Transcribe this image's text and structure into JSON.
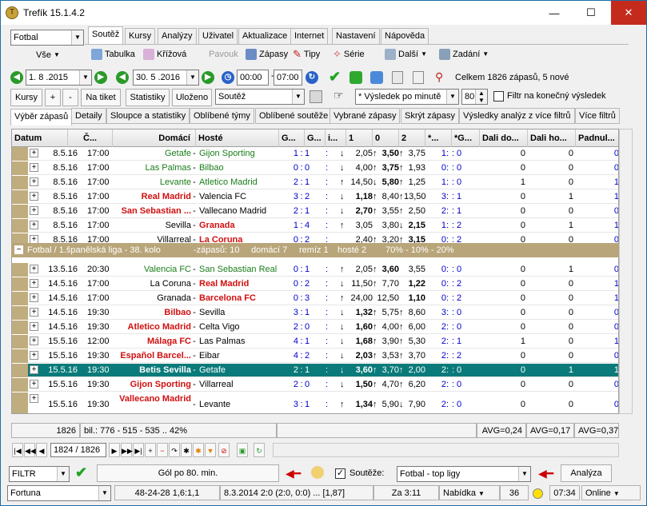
{
  "window": {
    "title": "Trefík 15.1.4.2",
    "minimize": "—",
    "maximize": "☐",
    "close": "✕"
  },
  "sport_select": "Fotbal",
  "all_select": "Vše",
  "menu_tabs": [
    "Soutěž",
    "Kursy",
    "Analýzy",
    "Uživatel",
    "Aktualizace",
    "Internet",
    "Nastavení",
    "Nápověda"
  ],
  "toolbar": {
    "tabulka": "Tabulka",
    "krizova": "Křížová",
    "pavouk": "Pavouk",
    "zapasy": "Zápasy",
    "tipy": "Tipy",
    "serie": "Série",
    "dalsi": "Další",
    "zadani": "Zadání"
  },
  "date_from": "1. 8 .2015",
  "date_to": "30. 5 .2016",
  "time_from": "00:00",
  "time_to": "07:00",
  "summary": "Celkem 1826 zápasů, 5 nové",
  "filter_row": {
    "kursy": "Kursy",
    "plus": "+",
    "minus": "-",
    "na_tiket": "Na tiket",
    "statistiky": "Statistiky",
    "ulozeno": "Uloženo",
    "soutez": "Soutěž",
    "vysledek": "* Výsledek po minutě",
    "minute": "80",
    "filtr_konecny": "Filtr na konečný výsledek"
  },
  "sub_tabs": [
    "Výběr zápasů",
    "Detaily",
    "Sloupce a statistiky",
    "Oblíbené týmy",
    "Oblíbené soutěže",
    "Vybrané zápasy",
    "Skrýt zápasy",
    "Výsledky analýz z více filtrů",
    "Více filtrů"
  ],
  "columns": [
    "Datum",
    "Č...",
    "Domácí",
    "Hosté",
    "G...",
    "G...",
    "i...",
    "1",
    "0",
    "2",
    "*...",
    "*G...",
    "Dali do...",
    "Dali ho...",
    "Padnul..."
  ],
  "rows_top": [
    {
      "date": "8.5.16",
      "time": "17:00",
      "home": "Getafe",
      "away": "Gijon Sporting",
      "hs": "green",
      "as": "green",
      "g1": "1",
      "g2": "1",
      "o1": "2,05",
      "o0": "3,50",
      "o2": "3,75",
      "b0": "bold",
      "h1": "1",
      "h2": "0",
      "d1": "0",
      "d2": "0",
      "p": "0",
      "a1": "down",
      "a0": "up",
      "a2": "up"
    },
    {
      "date": "8.5.16",
      "time": "17:00",
      "home": "Las Palmas",
      "away": "Bilbao",
      "hs": "green",
      "as": "green",
      "g1": "0",
      "g2": "0",
      "o1": "4,00",
      "o0": "3,75",
      "o2": "1,93",
      "b0": "bold",
      "h1": "0",
      "h2": "0",
      "d1": "0",
      "d2": "0",
      "p": "0",
      "a1": "down",
      "a0": "up",
      "a2": "up"
    },
    {
      "date": "8.5.16",
      "time": "17:00",
      "home": "Levante",
      "away": "Atletico Madrid",
      "hs": "green",
      "as": "green",
      "g1": "2",
      "g2": "1",
      "o1": "14,50",
      "o0": "5,80",
      "o2": "1,25",
      "b0": "bold",
      "h1": "1",
      "h2": "0",
      "d1": "1",
      "d2": "0",
      "p": "1",
      "a1": "up",
      "a0": "down",
      "a2": "up"
    },
    {
      "date": "8.5.16",
      "time": "17:00",
      "home": "Real Madrid",
      "away": "Valencia FC",
      "hs": "red",
      "as": "",
      "g1": "3",
      "g2": "2",
      "o1": "1,18",
      "o0": "8,40",
      "o2": "13,50",
      "b1": "bold",
      "h1": "3",
      "h2": "1",
      "d1": "0",
      "d2": "1",
      "p": "1",
      "a1": "down",
      "a0": "up",
      "a2": "up"
    },
    {
      "date": "8.5.16",
      "time": "17:00",
      "home": "San Sebastian ...",
      "away": "Vallecano Madrid",
      "hs": "red",
      "as": "",
      "g1": "2",
      "g2": "1",
      "o1": "2,70",
      "o0": "3,55",
      "o2": "2,50",
      "b1": "bold",
      "h1": "2",
      "h2": "1",
      "d1": "0",
      "d2": "0",
      "p": "0",
      "a1": "down",
      "a0": "up",
      "a2": "up"
    },
    {
      "date": "8.5.16",
      "time": "17:00",
      "home": "Sevilla",
      "away": "Granada",
      "hs": "",
      "as": "red",
      "g1": "1",
      "g2": "4",
      "o1": "3,05",
      "o0": "3,80",
      "o2": "2,15",
      "b2": "bold",
      "h1": "1",
      "h2": "2",
      "d1": "0",
      "d2": "1",
      "p": "1",
      "a1": "up",
      "a0": "",
      "a2": "down"
    },
    {
      "date": "8.5.16",
      "time": "17:00",
      "home": "Villarreal",
      "away": "La Coruna",
      "hs": "",
      "as": "red",
      "g1": "0",
      "g2": "2",
      "o1": "2,40",
      "o0": "3,20",
      "o2": "3,15",
      "b2": "bold",
      "h1": "0",
      "h2": "2",
      "d1": "0",
      "d2": "0",
      "p": "0",
      "a1": "",
      "a0": "up",
      "a2": "up"
    }
  ],
  "group": {
    "label": "Fotbal / 1.španělská liga - 38. kolo",
    "zapasu": "-zápasů: 10",
    "domaci": "domácí 7",
    "remiza": "remíz 1",
    "hoste": "hosté 2",
    "pct": "70% - 10% - 20%"
  },
  "rows_bottom": [
    {
      "date": "13.5.16",
      "time": "20:30",
      "home": "Valencia FC",
      "away": "San Sebastian Real",
      "hs": "green",
      "as": "green",
      "g1": "0",
      "g2": "1",
      "o1": "2,05",
      "o0": "3,60",
      "o2": "3,55",
      "b0": "bold",
      "h1": "0",
      "h2": "0",
      "d1": "0",
      "d2": "1",
      "p": "0",
      "a1": "up",
      "a0": "up",
      "a2": ""
    },
    {
      "date": "14.5.16",
      "time": "17:00",
      "home": "La Coruna",
      "away": "Real Madrid",
      "hs": "",
      "as": "red",
      "g1": "0",
      "g2": "2",
      "o1": "11,50",
      "o0": "7,70",
      "o2": "1,22",
      "b2": "bold",
      "h1": "0",
      "h2": "2",
      "d1": "0",
      "d2": "0",
      "p": "1",
      "a1": "down",
      "a0": "up",
      "a2": ""
    },
    {
      "date": "14.5.16",
      "time": "17:00",
      "home": "Granada",
      "away": "Barcelona FC",
      "hs": "",
      "as": "red",
      "g1": "0",
      "g2": "3",
      "o1": "24,00",
      "o0": "12,50",
      "o2": "1,10",
      "b2": "bold",
      "h1": "0",
      "h2": "2",
      "d1": "0",
      "d2": "0",
      "p": "1",
      "a1": "up",
      "a0": "",
      "a2": ""
    },
    {
      "date": "14.5.16",
      "time": "19:30",
      "home": "Bilbao",
      "away": "Sevilla",
      "hs": "red",
      "as": "",
      "g1": "3",
      "g2": "1",
      "o1": "1,32",
      "o0": "5,75",
      "o2": "8,60",
      "b1": "bold",
      "h1": "3",
      "h2": "0",
      "d1": "0",
      "d2": "0",
      "p": "0",
      "a1": "down",
      "a0": "up",
      "a2": "up"
    },
    {
      "date": "14.5.16",
      "time": "19:30",
      "home": "Atletico Madrid",
      "away": "Celta Vigo",
      "hs": "red",
      "as": "",
      "g1": "2",
      "g2": "0",
      "o1": "1,60",
      "o0": "4,00",
      "o2": "6,00",
      "b1": "bold",
      "h1": "2",
      "h2": "0",
      "d1": "0",
      "d2": "0",
      "p": "0",
      "a1": "down",
      "a0": "up",
      "a2": "up"
    },
    {
      "date": "15.5.16",
      "time": "12:00",
      "home": "Málaga FC",
      "away": "Las Palmas",
      "hs": "red",
      "as": "",
      "g1": "4",
      "g2": "1",
      "o1": "1,68",
      "o0": "3,90",
      "o2": "5,30",
      "b1": "bold",
      "h1": "2",
      "h2": "1",
      "d1": "1",
      "d2": "0",
      "p": "1",
      "a1": "down",
      "a0": "up",
      "a2": "up"
    },
    {
      "date": "15.5.16",
      "time": "19:30",
      "home": "Español Barcel...",
      "away": "Eibar",
      "hs": "red",
      "as": "",
      "g1": "4",
      "g2": "2",
      "o1": "2,03",
      "o0": "3,53",
      "o2": "3,70",
      "b1": "bold",
      "h1": "2",
      "h2": "2",
      "d1": "0",
      "d2": "0",
      "p": "0",
      "a1": "down",
      "a0": "up",
      "a2": "up"
    },
    {
      "date": "15.5.16",
      "time": "19:30",
      "home": "Betis Sevilla",
      "away": "Getafe",
      "hs": "",
      "as": "",
      "g1": "2",
      "g2": "1",
      "o1": "3,60",
      "o0": "3,70",
      "o2": "2,00",
      "b1": "bold",
      "h1": "2",
      "h2": "0",
      "d1": "0",
      "d2": "1",
      "p": "1",
      "a1": "down",
      "a0": "up",
      "a2": "up",
      "selected": true
    },
    {
      "date": "15.5.16",
      "time": "19:30",
      "home": "Gijon Sporting",
      "away": "Villarreal",
      "hs": "red",
      "as": "",
      "g1": "2",
      "g2": "0",
      "o1": "1,50",
      "o0": "4,70",
      "o2": "6,20",
      "b1": "bold",
      "h1": "2",
      "h2": "0",
      "d1": "0",
      "d2": "0",
      "p": "0",
      "a1": "down",
      "a0": "up",
      "a2": "up"
    },
    {
      "date": "15.5.16",
      "time": "19:30",
      "home": "Vallecano Madrid",
      "away": "Levante",
      "hs": "red",
      "as": "",
      "g1": "3",
      "g2": "1",
      "o1": "1,34",
      "o0": "5,90",
      "o2": "7,90",
      "b1": "bold",
      "h1": "2",
      "h2": "0",
      "d1": "0",
      "d2": "0",
      "p": "0",
      "a1": "up",
      "a0": "up",
      "a2": "down",
      "tall": true
    }
  ],
  "footer": {
    "count": "1826",
    "bil": "bil.: 776 - 515 - 535 .. 42%",
    "avg1": "AVG=0,24",
    "avg2": "AVG=0,17",
    "avg3": "AVG=0,37"
  },
  "nav": {
    "position": "1824 / 1826"
  },
  "bottom": {
    "filtr": "FILTR",
    "gol_button": "Gól po 80. min.",
    "souteze": "Soutěže:",
    "soutez_select": "Fotbal - top ligy",
    "analyza": "Analýza"
  },
  "status": {
    "profile": "Fortuna",
    "score": "48-24-28  1,6:1,1",
    "match": "8.3.2014 2:0 (2:0, 0:0) ... [1,87]",
    "za": "Za 3:11",
    "nabidka": "Nabídka",
    "num": "36",
    "time": "07:34",
    "online": "Online"
  }
}
